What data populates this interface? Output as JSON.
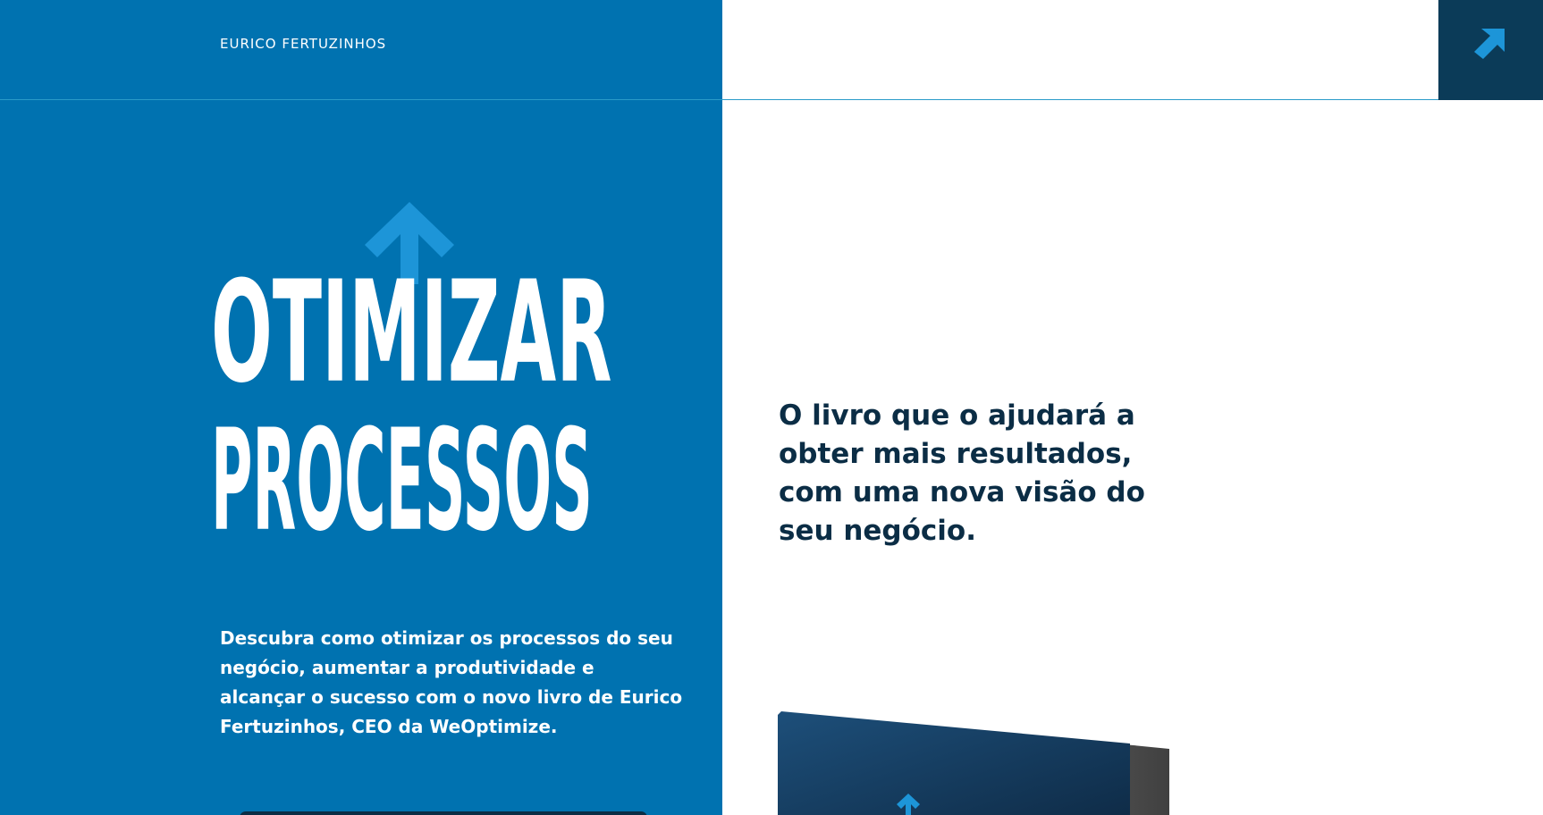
{
  "header": {
    "author_name": "EURICO FERTUZINHOS",
    "corner_icon": "arrow-up-right-icon"
  },
  "hero": {
    "title_line1": "OTIMIZAR",
    "title_line2": "PROCESSOS",
    "title_icon": "arrow-up-icon",
    "description": "Descubra como otimizar os processos do seu negócio, aumentar a produtividade e alcançar o sucesso com o novo livro de Eurico Fertuzinhos, CEO da WeOptimize."
  },
  "aside": {
    "tagline": "O livro que o ajudará a obter mais resultados, com uma nova visão do seu negócio."
  },
  "colors": {
    "brand_blue": "#0072b0",
    "accent_blue": "#1d95d8",
    "dark_navy": "#0b2d45",
    "corner_navy": "#0b3b58"
  }
}
